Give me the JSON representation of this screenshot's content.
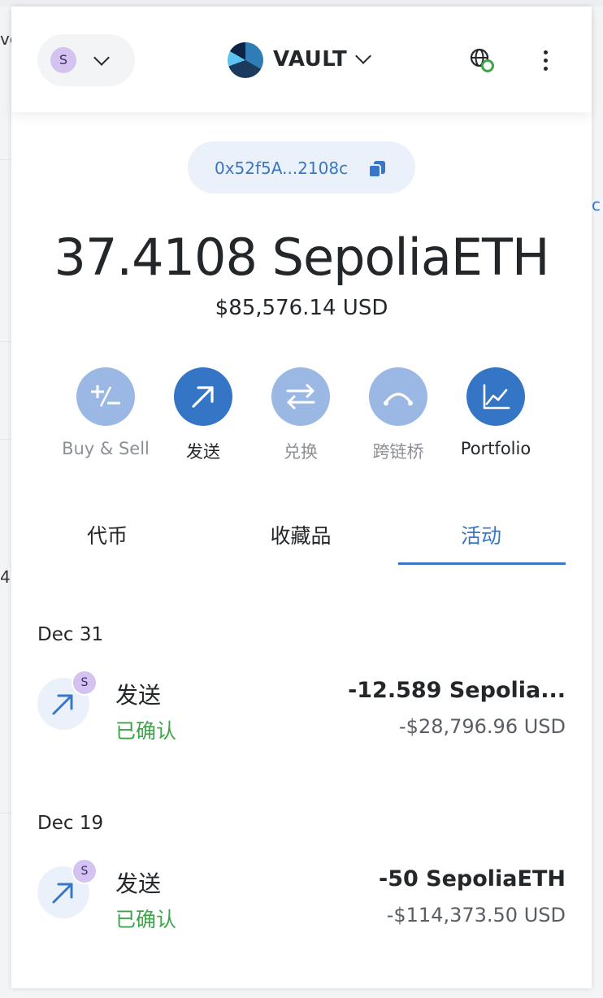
{
  "page_bg_fragments": {
    "left_text_1": "ve",
    "left_text_2": "4",
    "right_text": "c"
  },
  "header": {
    "network_avatar": "S",
    "account_name": "VAULT",
    "icons": [
      "chevron-down-icon",
      "globe-connected-icon",
      "kebab-menu-icon"
    ]
  },
  "address": {
    "short": "0x52f5A...2108c"
  },
  "balance": {
    "primary": "37.4108 SepoliaETH",
    "fiat": "$85,576.14 USD"
  },
  "actions": [
    {
      "label": "Buy & Sell",
      "icon": "plus-minus-icon",
      "enabled": false
    },
    {
      "label": "发送",
      "icon": "arrow-up-right-icon",
      "enabled": true
    },
    {
      "label": "兑换",
      "icon": "swap-arrows-icon",
      "enabled": false
    },
    {
      "label": "跨链桥",
      "icon": "bridge-icon",
      "enabled": false
    },
    {
      "label": "Portfolio",
      "icon": "chart-line-icon",
      "enabled": true
    }
  ],
  "tabs": [
    {
      "label": "代币",
      "active": false
    },
    {
      "label": "收藏品",
      "active": false
    },
    {
      "label": "活动",
      "active": true
    }
  ],
  "activity": [
    {
      "date": "Dec 31",
      "badge": "S",
      "title": "发送",
      "status": "已确认",
      "amount": "-12.589 Sepolia...",
      "fiat": "-$28,796.96 USD"
    },
    {
      "date": "Dec 19",
      "badge": "S",
      "title": "发送",
      "status": "已确认",
      "amount": "-50 SepoliaETH",
      "fiat": "-$114,373.50 USD"
    }
  ],
  "colors": {
    "accent": "#3a76c7",
    "accent_dark": "#3475c6",
    "disabled": "#9ab8e3",
    "success": "#3ea54b",
    "avatar": "#d4c2f1"
  }
}
